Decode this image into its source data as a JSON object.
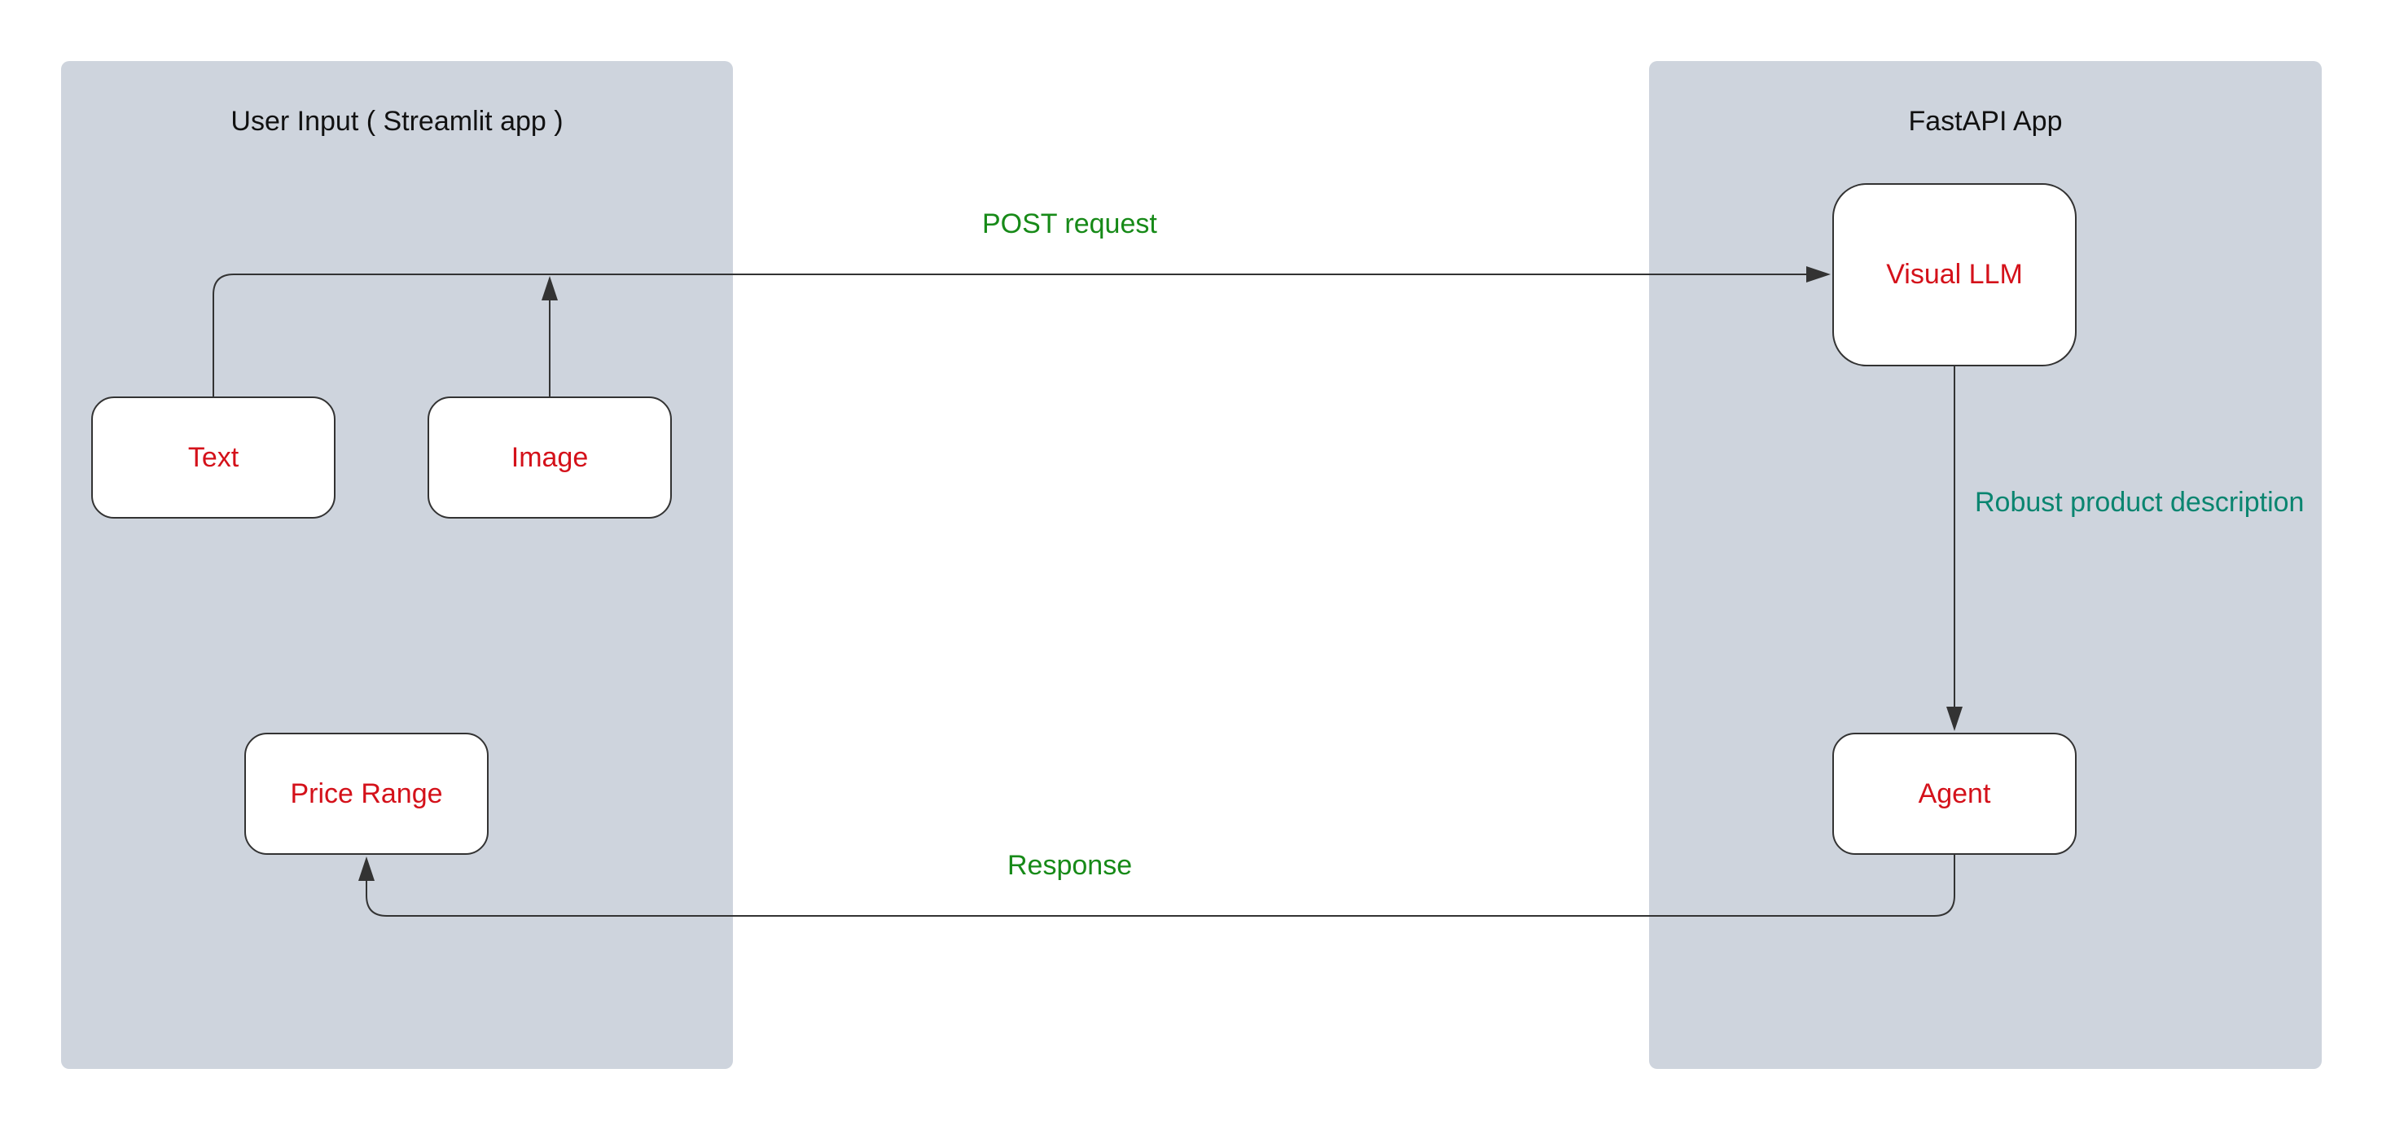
{
  "panels": {
    "left": {
      "title": "User Input ( Streamlit app )"
    },
    "right": {
      "title": "FastAPI App"
    }
  },
  "nodes": {
    "text": {
      "label": "Text"
    },
    "image": {
      "label": "Image"
    },
    "price_range": {
      "label": "Price Range"
    },
    "visual_llm": {
      "label": "Visual LLM"
    },
    "agent": {
      "label": "Agent"
    }
  },
  "edges": {
    "post_request": {
      "label": "POST request"
    },
    "response": {
      "label": "Response"
    },
    "robust_description": {
      "label": "Robust product description"
    }
  },
  "colors": {
    "panel_background": "#ced4dd",
    "node_label": "#d4111a",
    "edge_label_green": "#178a18",
    "edge_label_teal": "#0a8570",
    "connector": "#333333"
  }
}
